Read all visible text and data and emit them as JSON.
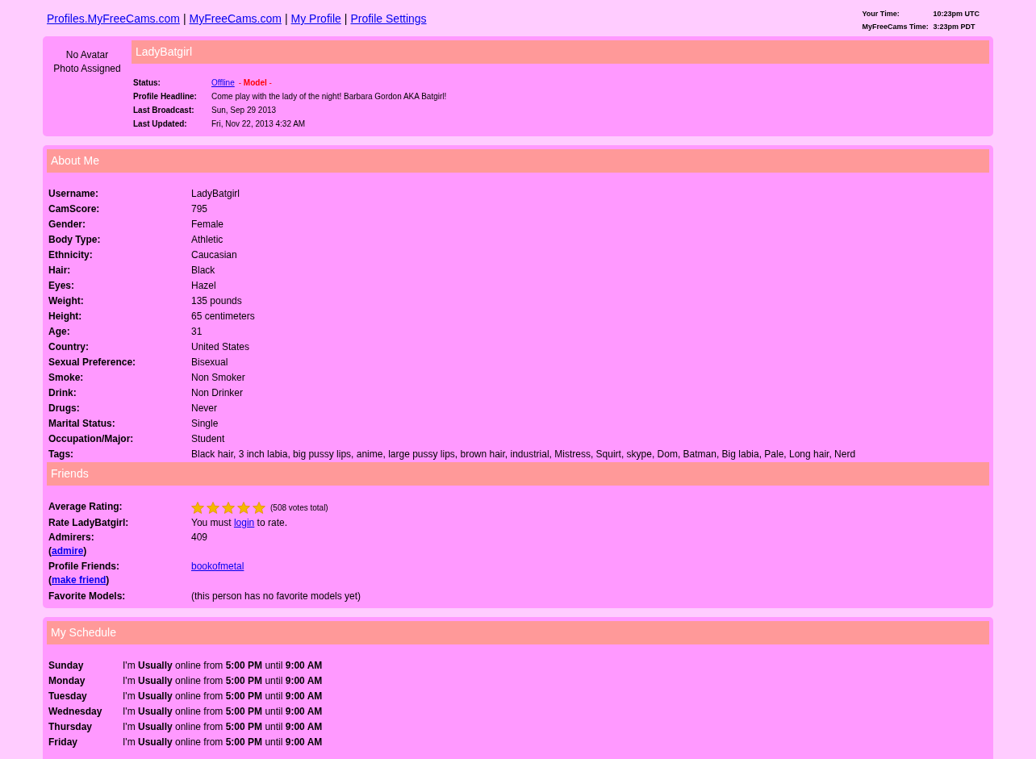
{
  "nav_links": [
    "Profiles.MyFreeCams.com",
    "MyFreeCams.com",
    "My Profile",
    "Profile Settings"
  ],
  "nav_separator": "|",
  "times": [
    {
      "label": "Your Time:",
      "value": "10:23pm UTC"
    },
    {
      "label": "MyFreeCams Time:",
      "value": "3:23pm PDT"
    }
  ],
  "profile": {
    "avatar_text": "No Avatar Photo Assigned",
    "name": "LadyBatgirl",
    "status": {
      "label": "Status:",
      "link": "Offline",
      "role": "- **Model** -"
    },
    "fields": [
      {
        "label": "Profile Headline:",
        "value": "Come play with the lady of the night! Barbara Gordon AKA Batgirl!"
      },
      {
        "label": "Last Broadcast:",
        "value": "Sun, Sep 29 2013"
      },
      {
        "label": "Last Updated:",
        "value": "Fri, Nov 22, 2013 4:32 AM"
      }
    ]
  },
  "about": {
    "title": "About Me",
    "fields": [
      {
        "label": "Username:",
        "value": "LadyBatgirl"
      },
      {
        "label": "CamScore:",
        "value": "795"
      },
      {
        "label": "Gender:",
        "value": "Female"
      },
      {
        "label": "Body Type:",
        "value": "Athletic"
      },
      {
        "label": "Ethnicity:",
        "value": "Caucasian"
      },
      {
        "label": "Hair:",
        "value": "Black"
      },
      {
        "label": "Eyes:",
        "value": "Hazel"
      },
      {
        "label": "Weight:",
        "value": "135 pounds"
      },
      {
        "label": "Height:",
        "value": "65 centimeters"
      },
      {
        "label": "Age:",
        "value": "31"
      },
      {
        "label": "Country:",
        "value": "United States"
      },
      {
        "label": "Sexual Preference:",
        "value": "Bisexual"
      },
      {
        "label": "Smoke:",
        "value": "Non Smoker"
      },
      {
        "label": "Drink:",
        "value": "Non Drinker"
      },
      {
        "label": "Drugs:",
        "value": "Never"
      },
      {
        "label": "Marital Status:",
        "value": "Single"
      },
      {
        "label": "Occupation/Major:",
        "value": "Student"
      },
      {
        "label": "Tags:",
        "value": "Black hair, 3 inch labia, big pussy lips, anime, large pussy lips, brown hair, industrial, Mistress, Squirt, skype, Dom, Batman, Big labia, Pale, Long hair, Nerd"
      }
    ]
  },
  "friends": {
    "title": "Friends",
    "rating": {
      "label": "Average Rating:",
      "stars": 5,
      "votes": "(508 votes total)"
    },
    "rate": {
      "label": "Rate LadyBatgirl:",
      "before": "You must",
      "link": "login",
      "after": "to rate."
    },
    "admirers": {
      "label": "Admirers:",
      "open": "(",
      "action": "admire",
      "close": ")",
      "value": "409"
    },
    "profile_friends": {
      "label": "Profile Friends:",
      "open": "(",
      "action": "make friend",
      "close": ")",
      "links": [
        "bookofmetal"
      ]
    },
    "favorites": {
      "label": "Favorite Models:",
      "value": "(this person has no favorite models yet)"
    }
  },
  "schedule": {
    "title": "My Schedule",
    "days": [
      {
        "day": "Sunday",
        "text": "I'm **Usually** online from **5:00 PM** until **9:00 AM**"
      },
      {
        "day": "Monday",
        "text": "I'm **Usually** online from **5:00 PM** until **9:00 AM**"
      },
      {
        "day": "Tuesday",
        "text": "I'm **Usually** online from **5:00 PM** until **9:00 AM**"
      },
      {
        "day": "Wednesday",
        "text": "I'm **Usually** online from **5:00 PM** until **9:00 AM**"
      },
      {
        "day": "Thursday",
        "text": "I'm **Usually** online from **5:00 PM** until **9:00 AM**"
      },
      {
        "day": "Friday",
        "text": "I'm **Usually** online from **5:00 PM** until **9:00 AM**"
      }
    ]
  }
}
